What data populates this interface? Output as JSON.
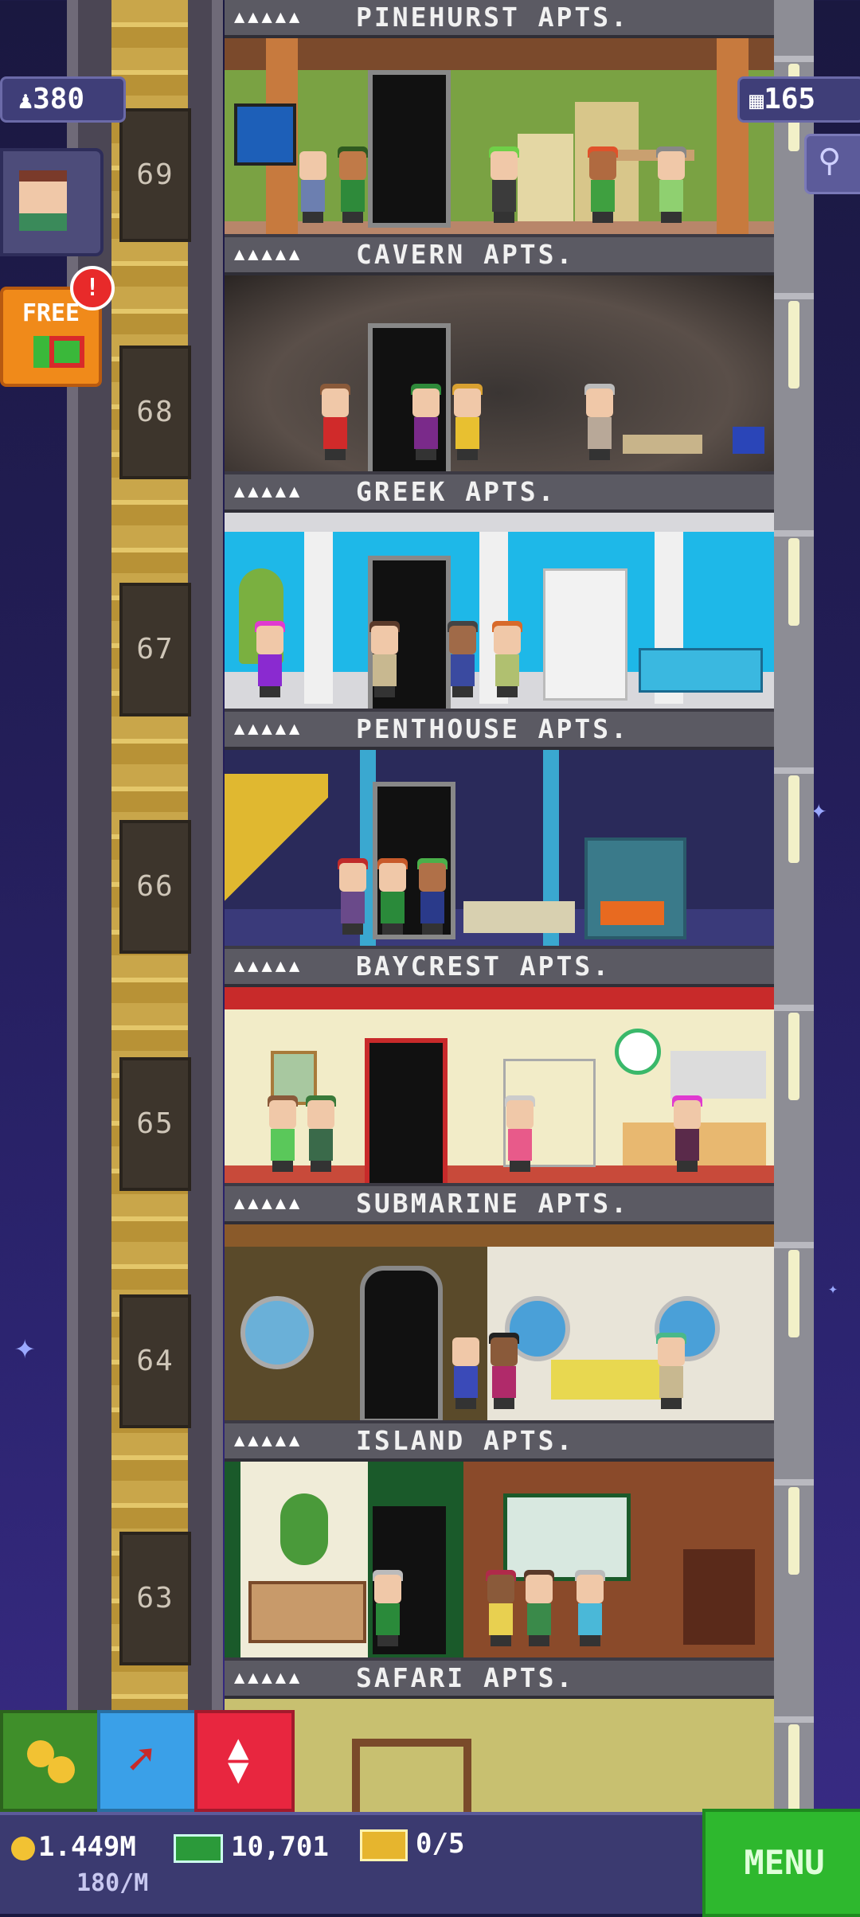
{
  "hud": {
    "population": "380",
    "floors": "165",
    "free_label": "FREE",
    "alert": "!"
  },
  "floors": [
    {
      "number": "69",
      "name": "PINEHURST APTS.",
      "stars": "▲▲▲▲▲"
    },
    {
      "number": "68",
      "name": "CAVERN APTS.",
      "stars": "▲▲▲▲▲"
    },
    {
      "number": "67",
      "name": "GREEK APTS.",
      "stars": "▲▲▲▲▲"
    },
    {
      "number": "66",
      "name": "PENTHOUSE APTS.",
      "stars": "▲▲▲▲▲"
    },
    {
      "number": "65",
      "name": "BAYCREST APTS.",
      "stars": "▲▲▲▲▲"
    },
    {
      "number": "64",
      "name": "SUBMARINE APTS.",
      "stars": "▲▲▲▲▲"
    },
    {
      "number": "63",
      "name": "ISLAND APTS.",
      "stars": "▲▲▲▲▲"
    },
    {
      "number": "",
      "name": "SAFARI APTS.",
      "stars": "▲▲▲▲▲"
    }
  ],
  "bottom": {
    "coins": "1.449M",
    "rate": "180/M",
    "bux": "10,701",
    "tickets": "0/5",
    "menu_label": "MENU"
  },
  "colors": {
    "coin": "#f2c233",
    "bux": "#2b9a3a",
    "menu": "#2eb82e",
    "elevator_btn": "#e8263f",
    "raffle_btn": "#3aa0e8",
    "coins_btn": "#3f8f2a"
  },
  "icons": [
    "people-icon",
    "floors-icon",
    "search-icon",
    "gift-icon",
    "coins-icon",
    "dig-icon",
    "elevator-icon"
  ]
}
